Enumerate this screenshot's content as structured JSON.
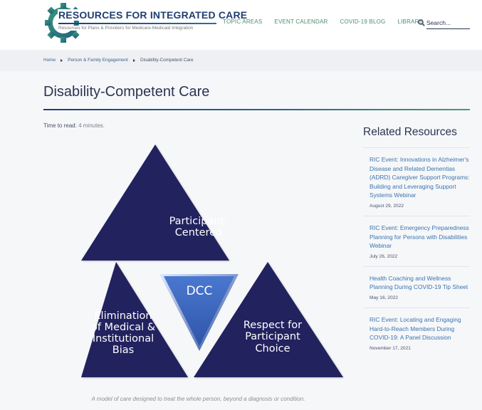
{
  "header": {
    "logo": {
      "title": "Resources for Integrated Care",
      "subtitle": "Resources for Plans & Providers for Medicare-Medicaid Integration"
    },
    "nav": [
      {
        "label": "TOPIC AREAS"
      },
      {
        "label": "EVENT CALENDAR"
      },
      {
        "label": "COVID-19 BLOG"
      },
      {
        "label": "LIBRARY"
      }
    ],
    "search": {
      "placeholder": "Search...",
      "icon": "search-icon"
    }
  },
  "breadcrumb": [
    {
      "label": "Home"
    },
    {
      "label": "Person & Family Engagement"
    },
    {
      "label": "Disability-Competent Care"
    }
  ],
  "main": {
    "title": "Disability-Competent Care",
    "read_time_label": "Time to read:",
    "read_time_value": "4 minutes.",
    "diagram": {
      "center": "DCC",
      "top": [
        "Participant-",
        "Centered"
      ],
      "bottom_left": [
        "Elimination",
        "of Medical &",
        "Institutional",
        "Bias"
      ],
      "bottom_right": [
        "Respect for",
        "Participant",
        "Choice"
      ],
      "colors": {
        "outer": "#22215f",
        "center": "#3b63b8"
      }
    },
    "caption": "A model of care designed to treat the whole person, beyond a diagnosis or condition."
  },
  "sidebar": {
    "title": "Related Resources",
    "items": [
      {
        "title": "RIC Event: Innovations in Alzheimer's Disease and Related Dementias (ADRD) Caregiver Support Programs: Building and Leveraging Support Systems Webinar",
        "date": "August 29, 2022"
      },
      {
        "title": "RIC Event: Emergency Preparedness Planning for Persons with Disabilities Webinar",
        "date": "July 26, 2022"
      },
      {
        "title": "Health Coaching and Wellness Planning During COVID-19 Tip Sheet",
        "date": "May 16, 2022"
      },
      {
        "title": "RIC Event: Locating and Engaging Hard-to-Reach Members During COVID-19: A Panel Discussion",
        "date": "November 17, 2021"
      }
    ]
  },
  "colors": {
    "nav_link": "#4a8f6a",
    "link": "#3a74b0",
    "heading": "#2b3452"
  }
}
